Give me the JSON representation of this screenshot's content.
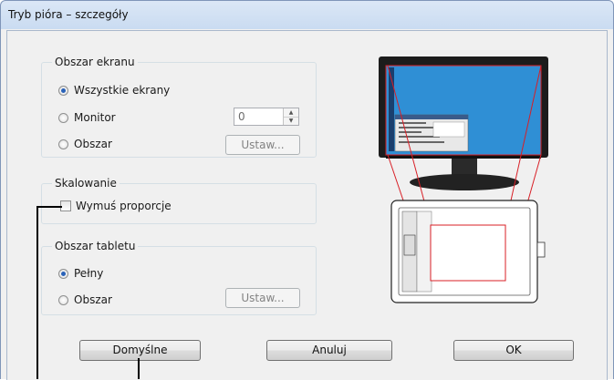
{
  "window": {
    "title": "Tryb pióra – szczegóły"
  },
  "screen_area": {
    "legend": "Obszar ekranu",
    "options": {
      "all": "Wszystkie ekrany",
      "monitor": "Monitor",
      "area": "Obszar"
    },
    "selected": "all",
    "monitor_value": "0",
    "set_button": "Ustaw..."
  },
  "scaling": {
    "legend": "Skalowanie",
    "force_proportions": "Wymuś proporcje",
    "checked": false
  },
  "tablet_area": {
    "legend": "Obszar tabletu",
    "options": {
      "full": "Pełny",
      "area": "Obszar"
    },
    "selected": "full",
    "set_button": "Ustaw..."
  },
  "buttons": {
    "defaults": "Domyślne",
    "cancel": "Anuluj",
    "ok": "OK"
  },
  "colors": {
    "accent": "#2a62b8",
    "screen_blue": "#2f8fd5",
    "mapping_line": "#d81f26"
  }
}
